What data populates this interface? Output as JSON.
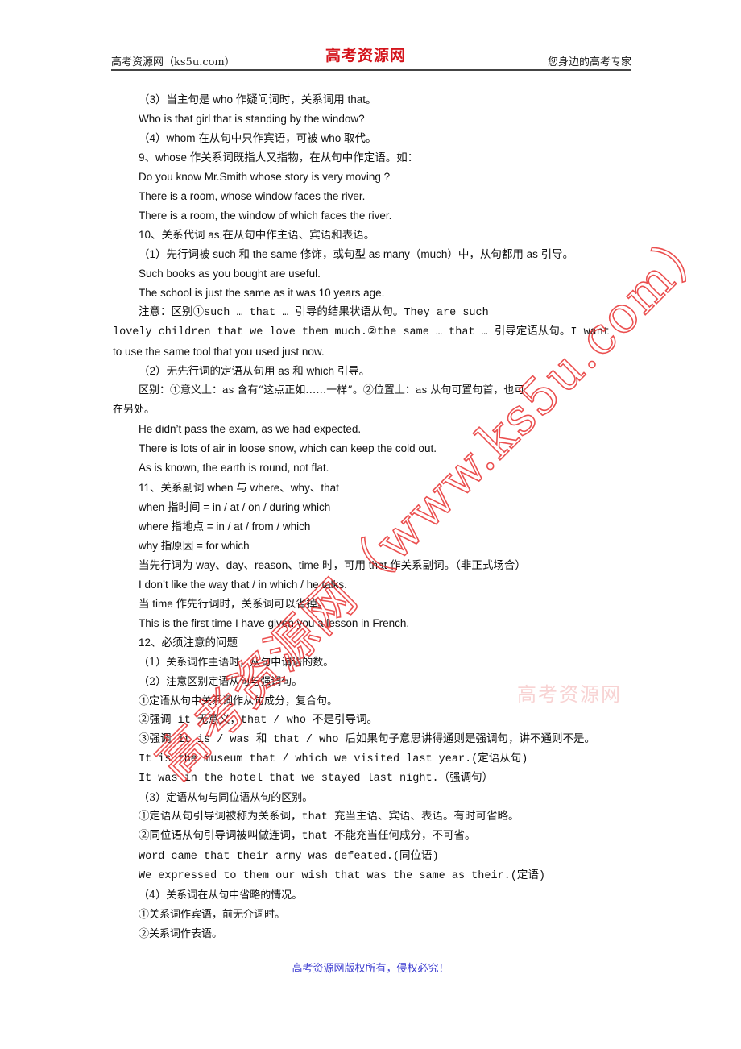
{
  "header": {
    "left": "高考资源网（ks5u.com）",
    "logo": "高考资源网",
    "right": "您身边的高考专家"
  },
  "lines": [
    "（3）当主句是 who 作疑问词时，关系词用 that。",
    "Who is that girl that is standing by the window?",
    "（4）whom 在从句中只作宾语，可被 who 取代。",
    "9、whose 作关系词既指人又指物，在从句中作定语。如：",
    "Do you know Mr.Smith whose story is very moving ?",
    "There is a room, whose window faces the river.",
    "There is a room, the window of which faces the river.",
    "10、关系代词 as,在从句中作主语、宾语和表语。",
    "（1）先行词被 such 和 the same 修饰，或句型 as many（much）中，从句都用 as  引导。",
    "Such books as you bought are useful.",
    "The school is just the same as it was 10 years age.",
    "注意：区别①such … that … 引导的结果状语从句。They are such",
    "lovely children that we love them much.②the same … that … 引导定语从句。I want",
    "to use the same tool that you used just now.",
    "（2）无先行词的定语从句用 as 和 which 引导。",
    "区别：①意义上：as 含有“这点正如……一样”。②位置上：as 从句可置句首，也可",
    "在另处。",
    "He didn’t pass the exam, as we had expected.",
    "There is lots of air in loose snow, which can keep the cold out.",
    "As is known, the earth is round, not flat.",
    "11、关系副词 when 与 where、why、that",
    "when  指时间  = in / at / on / during which",
    "where 指地点  = in / at / from / which",
    "why 指原因  = for which",
    "当先行词为 way、day、reason、time 时，可用 that 作关系副词。（非正式场合）",
    "I don’t like the way  that / in which / he talks.",
    "当 time 作先行词时，关系词可以省掉。",
    "This is the first time I have given you a lesson in French.",
    "12、必须注意的问题",
    "（1）关系词作主语时，从句中谓语的数。",
    "（2）注意区别定语从句与强调句。",
    "①定语从句中关系词作从句成分，复合句。",
    "②强调 it 无意义，that / who 不是引导词。",
    "③强调 it is / was 和 that / who 后如果句子意思讲得通则是强调句，讲不通则不是。",
    "It is the museum that / which we visited last year.(定语从句)",
    "It was in the hotel that we stayed last night.（强调句）",
    "（3）定语从句与同位语从句的区别。",
    "①定语从句引导词被称为关系词，that 充当主语、宾语、表语。有时可省略。",
    "②同位语从句引导词被叫做连词，that 不能充当任何成分，不可省。",
    "Word came that their army was defeated.(同位语)",
    "We expressed to them our wish that was the same as their.(定语)",
    "（4）关系词在从句中省略的情况。",
    "①关系词作宾语，前无介词时。",
    "②关系词作表语。"
  ],
  "watermark": {
    "diagonal": "高考资源网（www.ks5u.com）",
    "stamp": "高考资源网"
  },
  "footer": {
    "text": "高考资源网版权所有，侵权必究！"
  }
}
